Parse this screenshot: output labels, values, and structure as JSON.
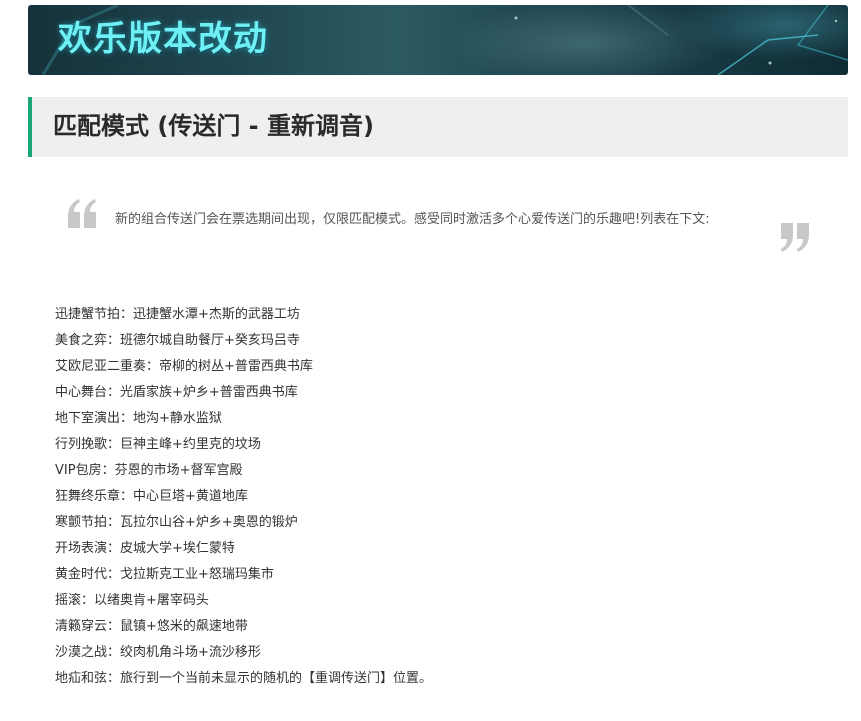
{
  "banner": {
    "title": "欢乐版本改动"
  },
  "section": {
    "title": "匹配模式 (传送门 - 重新调音)"
  },
  "quote": {
    "text": "新的组合传送门会在票选期间出现，仅限匹配模式。感受同时激活多个心爱传送门的乐趣吧!列表在下文:"
  },
  "modes": [
    "迅捷蟹节拍：迅捷蟹水潭+杰斯的武器工坊",
    "美食之弈：班德尔城自助餐厅+癸亥玛吕寺",
    "艾欧尼亚二重奏：帝柳的树丛+普雷西典书库",
    "中心舞台：光盾家族+炉乡+普雷西典书库",
    "地下室演出：地沟+静水监狱",
    "行列挽歌：巨神主峰+约里克的坟场",
    "VIP包房：芬恩的市场+督军宫殿",
    "狂舞终乐章：中心巨塔+黄道地库",
    "寒颤节拍：瓦拉尔山谷+炉乡+奥恩的锻炉",
    "开场表演：皮城大学+埃仁蒙特",
    "黄金时代：戈拉斯克工业+怒瑞玛集市",
    "摇滚：以绪奥肯+屠宰码头",
    "清籁穿云：鼠镇+悠米的飙速地带",
    "沙漠之战：绞肉机角斗场+流沙移形",
    "地疝和弦：旅行到一个当前未显示的随机的【重调传送门】位置。"
  ],
  "colors": {
    "accent": "#19a47a",
    "banner_text": "#6ff0f5",
    "quote_mark": "#c8c8c8"
  }
}
